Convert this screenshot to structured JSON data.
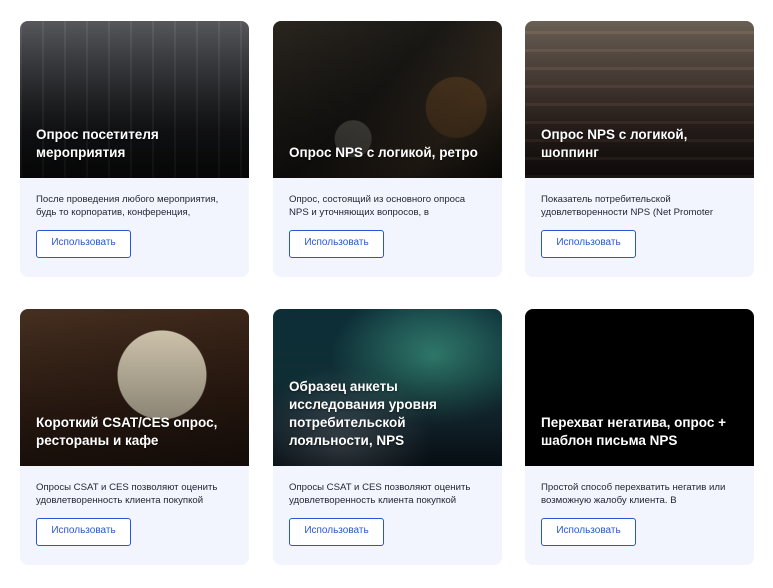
{
  "cards": [
    {
      "title": "Опрос посетителя мероприятия",
      "description": "После проведения любого мероприятия, будь то корпоратив, конференция,",
      "button_label": "Использовать"
    },
    {
      "title": "Опрос NPS с логикой, ретро",
      "description": "Опрос, состоящий из основного опроса NPS и уточняющих вопросов, в",
      "button_label": "Использовать"
    },
    {
      "title": "Опрос NPS с логикой, шоппинг",
      "description": "Показатель потребительской удовлетворенности NPS (Net Promoter",
      "button_label": "Использовать"
    },
    {
      "title": "Короткий CSAT/CES опрос, рестораны и кафе",
      "description": "Опросы CSAT и CES позволяют оценить удовлетворенность клиента покупкой",
      "button_label": "Использовать"
    },
    {
      "title": "Образец анкеты исследования уровня потребительской лояльности, NPS",
      "description": "Опросы CSAT и CES позволяют оценить удовлетворенность клиента покупкой",
      "button_label": "Использовать"
    },
    {
      "title": "Перехват негатива, опрос + шаблон письма NPS",
      "description": "Простой способ перехватить негатив или возможную жалобу клиента. В",
      "button_label": "Использовать"
    }
  ],
  "colors": {
    "accent": "#2b55d6",
    "card_background": "#f2f5fd",
    "text": "#1f2430"
  }
}
